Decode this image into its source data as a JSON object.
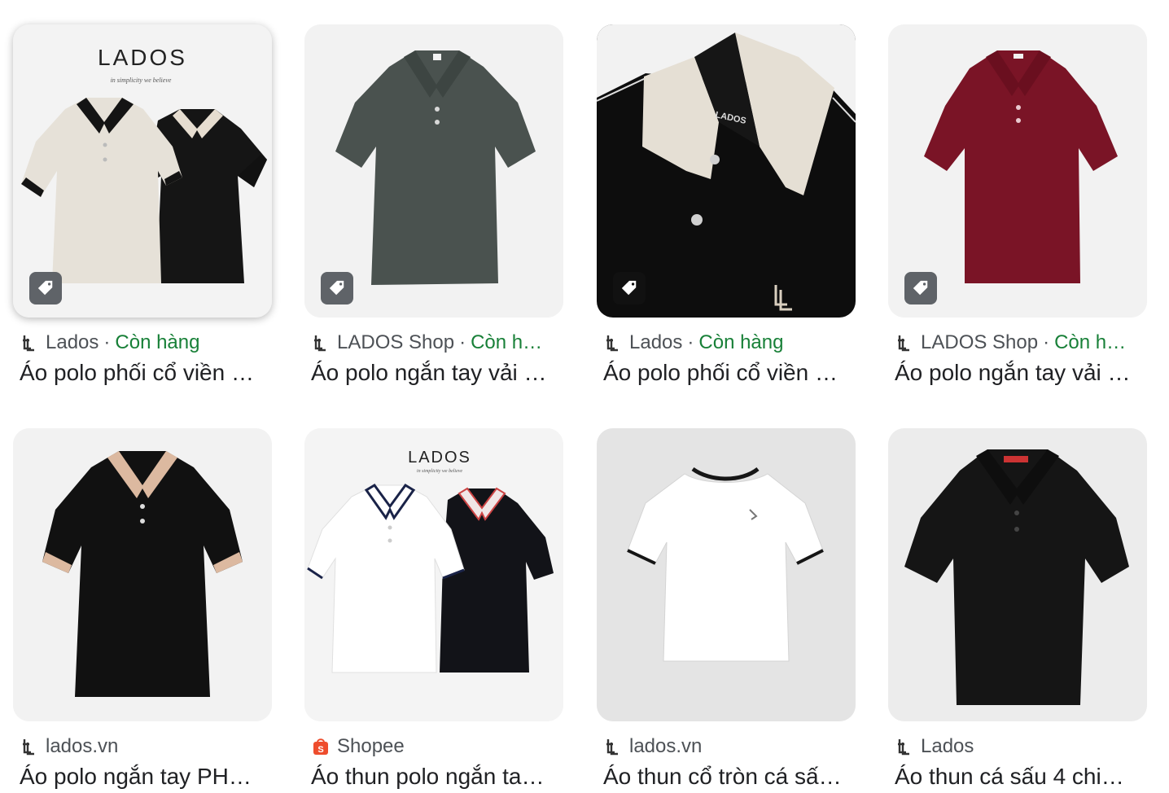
{
  "products": [
    {
      "source": "Lados",
      "stock": "Còn hàng",
      "title": "Áo polo phối cổ viền …",
      "brand_text": "LADOS",
      "tagline": "in simplicity we believe"
    },
    {
      "source": "LADOS Shop",
      "stock": "Còn h…",
      "title": "Áo polo ngắn tay vải …"
    },
    {
      "source": "Lados",
      "stock": "Còn hàng",
      "title": "Áo polo phối cổ viền …",
      "collar_label": "LADOS"
    },
    {
      "source": "LADOS Shop",
      "stock": "Còn h…",
      "title": "Áo polo ngắn tay vải …"
    },
    {
      "source": "lados.vn",
      "title": "Áo polo ngắn tay PH…"
    },
    {
      "source": "Shopee",
      "title": "Áo thun polo ngắn ta…",
      "brand_text": "LADOS",
      "tagline": "in simplicity we believe"
    },
    {
      "source": "lados.vn",
      "title": "Áo thun cổ tròn cá sấ…"
    },
    {
      "source": "Lados",
      "title": "Áo thun cá sấu 4 chi…"
    }
  ],
  "meta_separator": "·",
  "colors": {
    "stock_green": "#188038",
    "source_gray": "#4d5156",
    "tag_badge": "#5f6368",
    "shopee_orange": "#ee4d2d"
  },
  "icons": {
    "tag": "price-tag-icon",
    "lados_favicon": "lados-logo-icon",
    "shopee_favicon": "shopee-bag-icon"
  }
}
